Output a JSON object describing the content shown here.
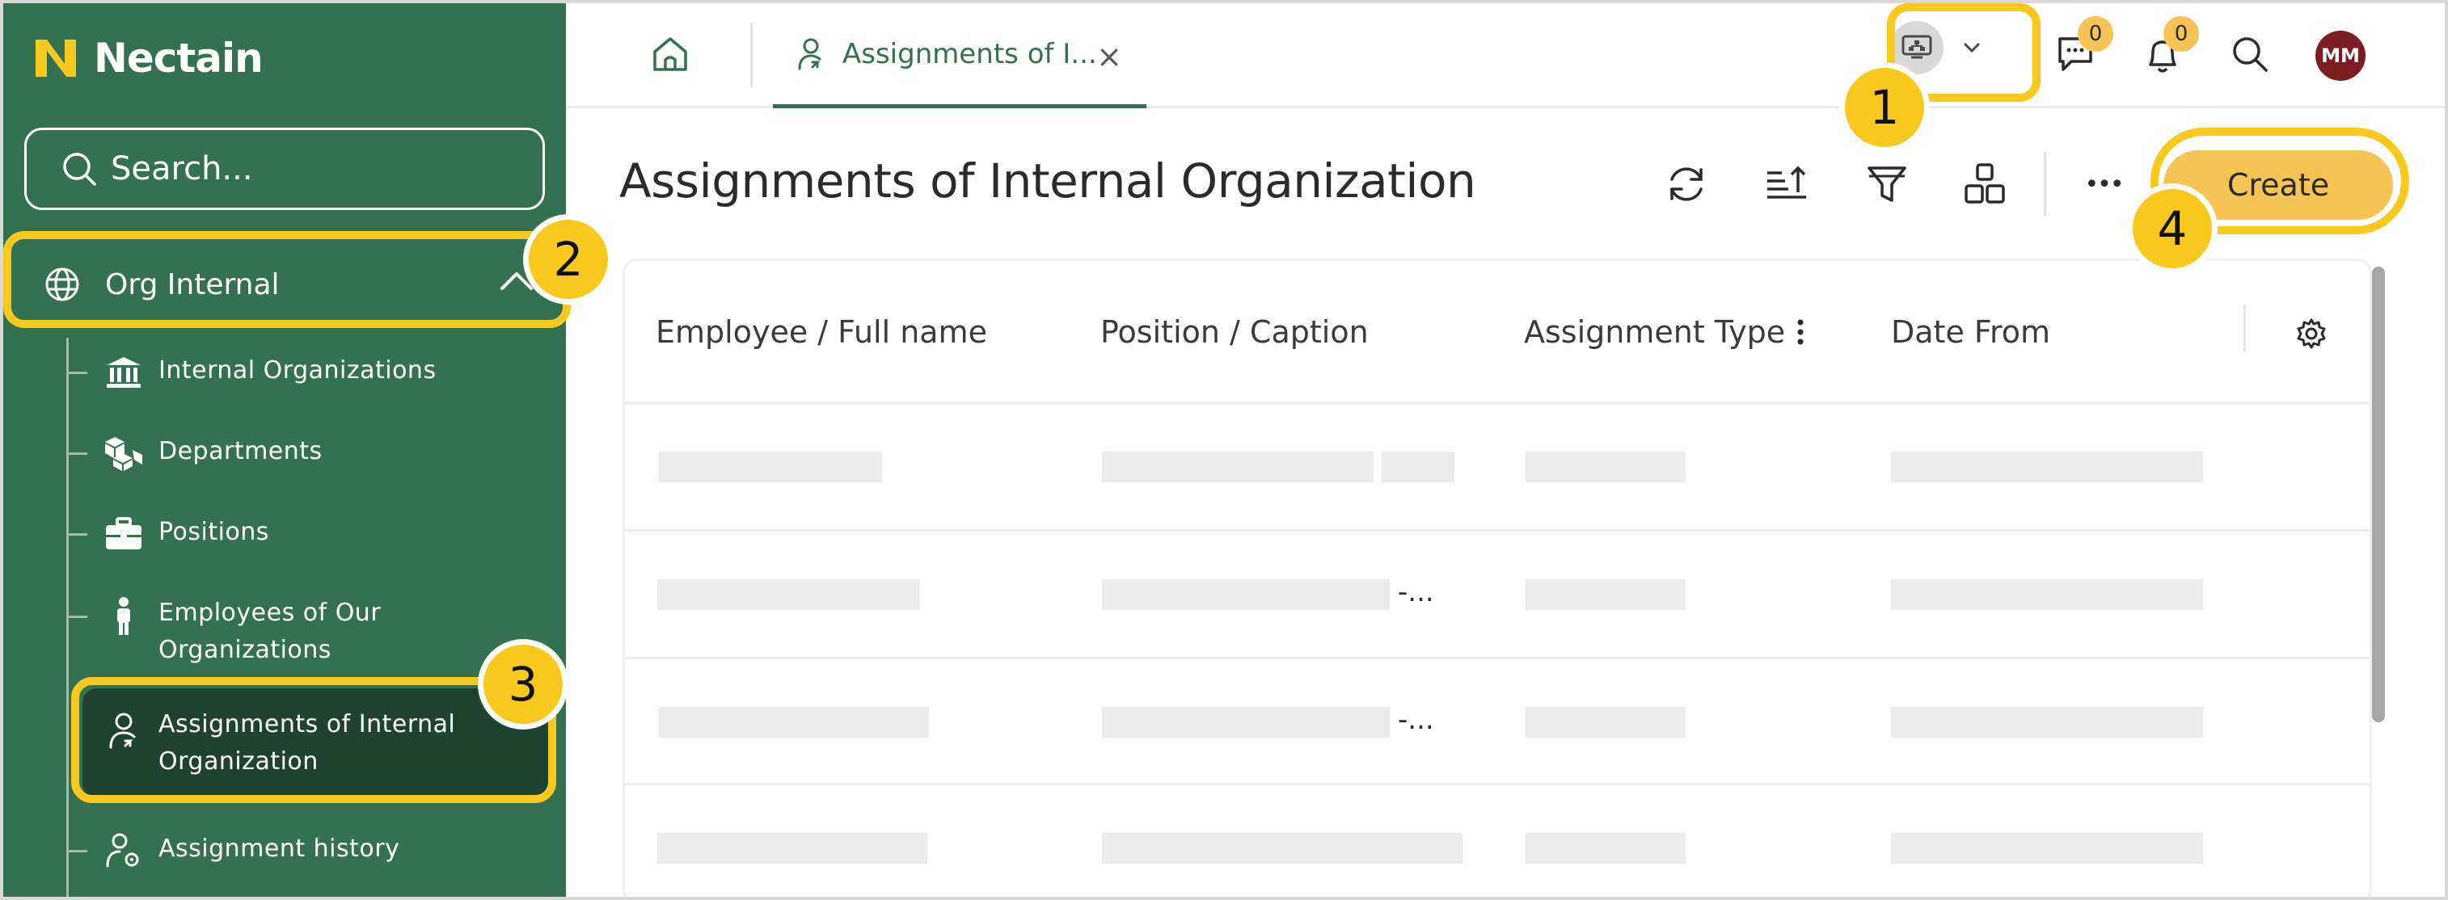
{
  "app": {
    "brand": "Nectain"
  },
  "colors": {
    "sidebar": "#347150",
    "accent": "#f6c454",
    "callout": "#f8c81c",
    "avatar": "#7a1e24"
  },
  "search": {
    "placeholder": "Search..."
  },
  "sidebar": {
    "group": {
      "label": "Org Internal",
      "icon": "globe-icon"
    },
    "items": [
      {
        "label": "Internal Organizations",
        "icon": "building-columns-icon"
      },
      {
        "label": "Departments",
        "icon": "boxes-icon"
      },
      {
        "label": "Positions",
        "icon": "briefcase-icon"
      },
      {
        "label_line1": "Employees of Our",
        "label_line2": "Organizations",
        "icon": "person-icon"
      },
      {
        "label_line1": "Assignments of Internal",
        "label_line2": "Organization",
        "icon": "user-assignment-icon",
        "active": true
      },
      {
        "label": "Assignment history",
        "icon": "user-gear-icon"
      }
    ]
  },
  "topbar": {
    "tab": {
      "label": "Assignments of I..."
    },
    "close_glyph": "×",
    "messages_count": "0",
    "notifications_count": "0",
    "avatar_initials": "MM"
  },
  "page": {
    "title": "Assignments of Internal Organization",
    "create_label": "Create",
    "more_glyph": "•••"
  },
  "table": {
    "columns": [
      "Employee / Full name",
      "Position / Caption",
      "Assignment Type",
      "Date From"
    ],
    "row_suffix": "-..."
  },
  "callouts": [
    "1",
    "2",
    "3",
    "4"
  ]
}
